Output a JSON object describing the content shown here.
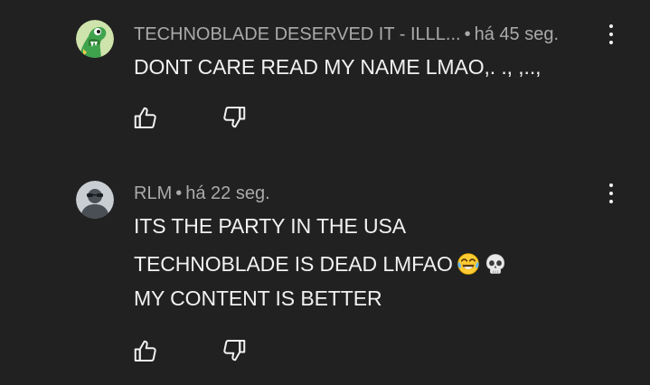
{
  "comments": [
    {
      "author": "TECHNOBLADE DESERVED IT - ILLL...",
      "separator": "•",
      "time": "há 45 seg.",
      "lines": [
        "DONT CARE READ MY NAME LMAO,. ., ,..,"
      ],
      "avatar_icon": "cartoon-dinosaur-avatar",
      "avatar_bg": "#c9e0a8"
    },
    {
      "author": "RLM",
      "separator": "•",
      "time": "há 22 seg.",
      "lines": [
        "ITS THE PARTY IN THE USA",
        "TECHNOBLADE IS DEAD LMFAO",
        "MY CONTENT IS BETTER"
      ],
      "emojis": [
        "tears-of-joy-emoji",
        "skull-emoji"
      ],
      "avatar_icon": "default-user-avatar",
      "avatar_bg": "#c7ccd1"
    }
  ],
  "icons": {
    "like": "thumbs-up-icon",
    "dislike": "thumbs-down-icon",
    "menu": "more-vert-icon"
  },
  "colors": {
    "background": "#212121",
    "primary_text": "#f1f1f1",
    "secondary_text": "#aaaaaa"
  }
}
